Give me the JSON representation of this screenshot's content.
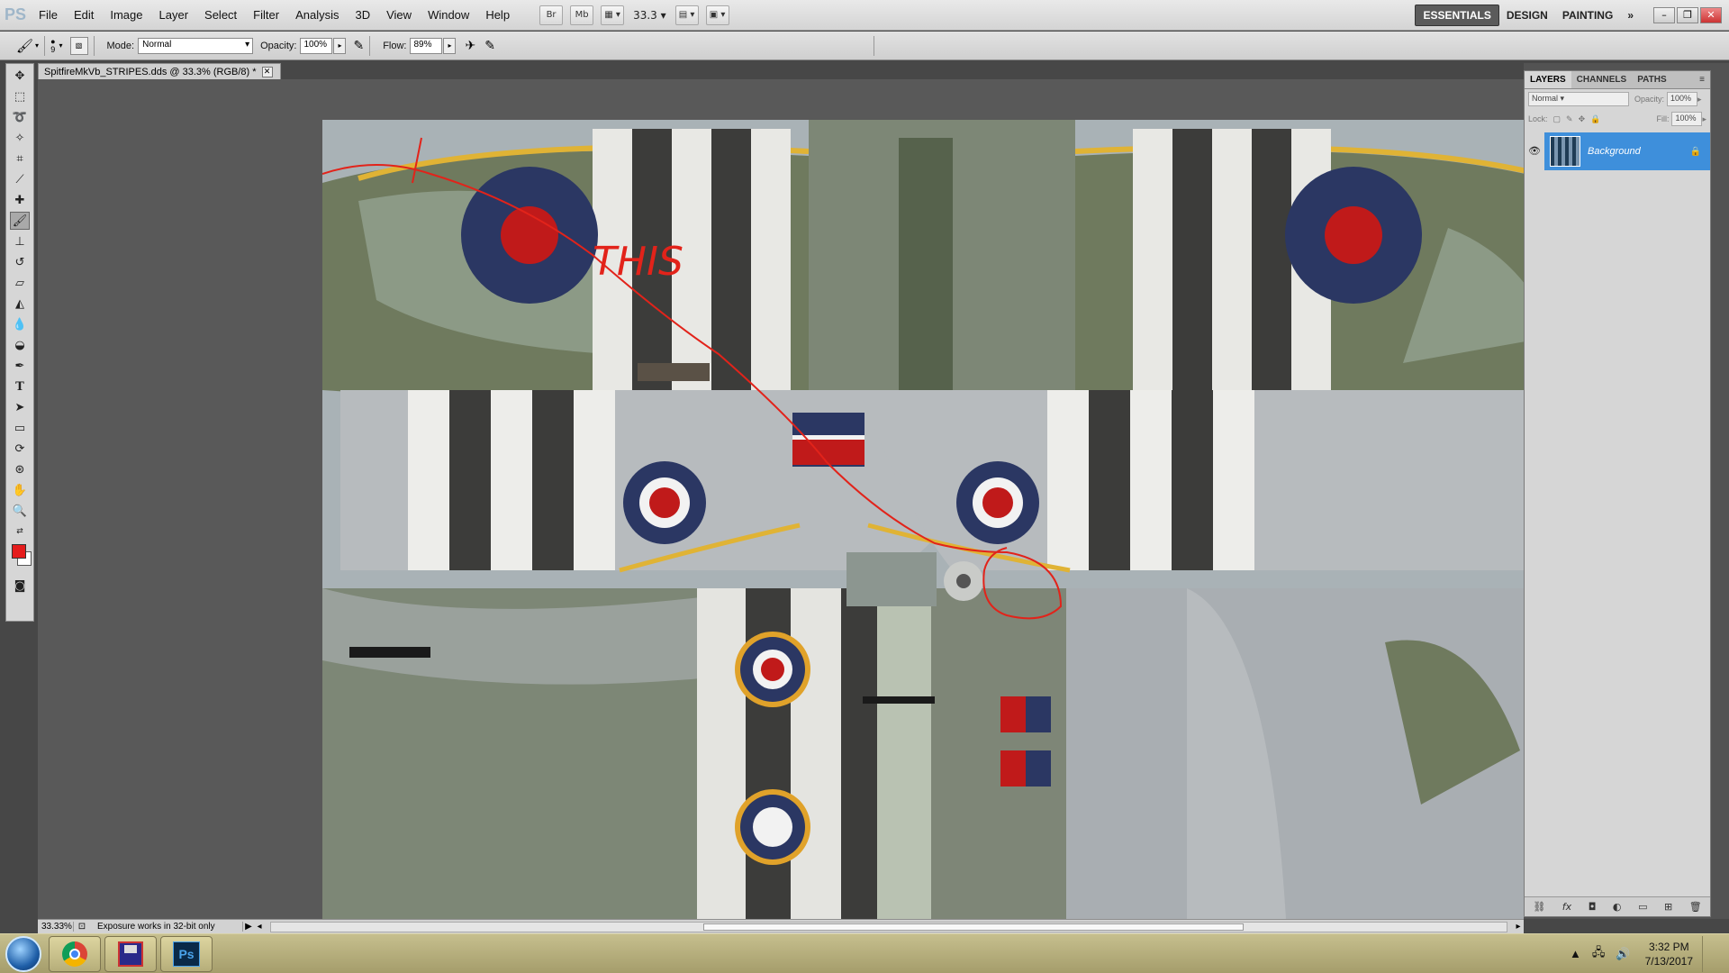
{
  "app": {
    "logo": "PS",
    "menu": [
      "File",
      "Edit",
      "Image",
      "Layer",
      "Select",
      "Filter",
      "Analysis",
      "3D",
      "View",
      "Window",
      "Help"
    ],
    "bridge_buttons": [
      "Br",
      "Mb"
    ],
    "zoom_level": "33.3",
    "workspaces": [
      "ESSENTIALS",
      "DESIGN",
      "PAINTING"
    ],
    "workspace_more": "»"
  },
  "options_bar": {
    "brush_size": "9",
    "mode_label": "Mode:",
    "mode_value": "Normal",
    "opacity_label": "Opacity:",
    "opacity_value": "100%",
    "flow_label": "Flow:",
    "flow_value": "89%"
  },
  "document": {
    "tab_title": "SpitfireMkVb_STRIPES.dds @ 33.3% (RGB/8) *",
    "annotation_text": "THIS",
    "foreground_color": "#e51c1c",
    "background_color": "#ffffff"
  },
  "status": {
    "zoom": "33.33%",
    "message": "Exposure works in 32-bit only"
  },
  "layers_panel": {
    "tabs": [
      "LAYERS",
      "CHANNELS",
      "PATHS"
    ],
    "blend_mode": "Normal",
    "opacity_label": "Opacity:",
    "opacity_value": "100%",
    "lock_label": "Lock:",
    "fill_label": "Fill:",
    "fill_value": "100%",
    "layers": [
      {
        "name": "Background",
        "visible": true,
        "locked": true
      }
    ],
    "footer_icons": [
      "link-icon",
      "fx-icon",
      "mask-icon",
      "adjustment-icon",
      "group-icon",
      "new-layer-icon",
      "trash-icon"
    ]
  },
  "taskbar": {
    "apps": [
      "chrome-icon",
      "save-icon",
      "photoshop-icon"
    ],
    "photoshop_label": "Ps",
    "time": "3:32 PM",
    "date": "7/13/2017"
  }
}
